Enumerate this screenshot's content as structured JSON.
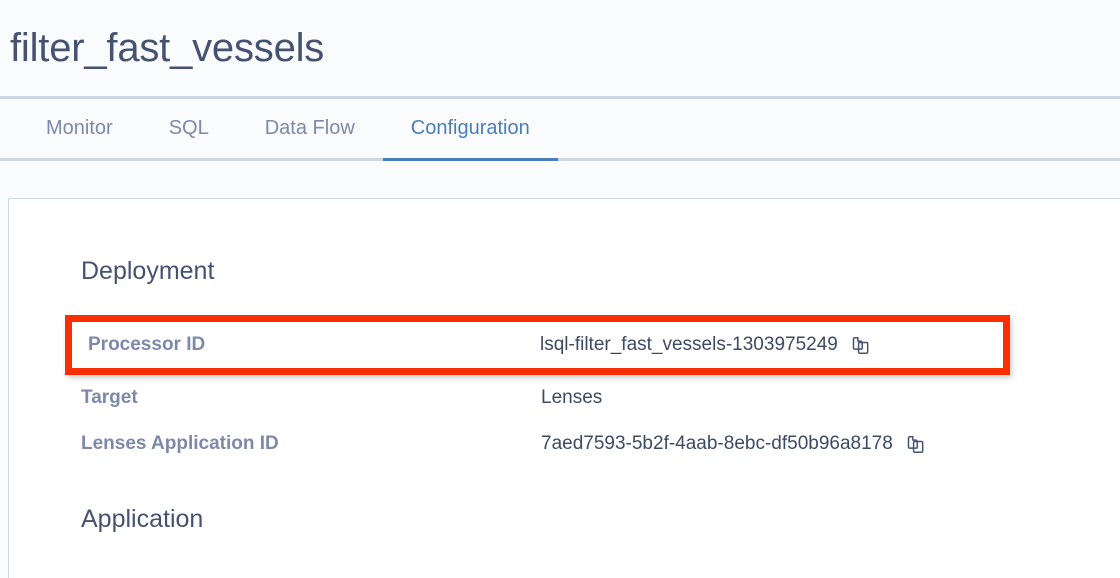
{
  "header": {
    "title": "filter_fast_vessels"
  },
  "tabs": [
    {
      "label": "Monitor",
      "active": false
    },
    {
      "label": "SQL",
      "active": false
    },
    {
      "label": "Data Flow",
      "active": false
    },
    {
      "label": "Configuration",
      "active": true
    }
  ],
  "sections": {
    "deployment": {
      "title": "Deployment",
      "rows": [
        {
          "label": "Processor ID",
          "value": "lsql-filter_fast_vessels-1303975249",
          "copy_icon": "copy-icon",
          "highlighted": true
        },
        {
          "label": "Target",
          "value": "Lenses",
          "copy_icon": null,
          "highlighted": false
        },
        {
          "label": "Lenses Application ID",
          "value": "7aed7593-5b2f-4aab-8ebc-df50b96a8178",
          "copy_icon": "copy-icon",
          "highlighted": false
        }
      ]
    },
    "application": {
      "title": "Application"
    }
  },
  "colors": {
    "accent": "#4a7ebb",
    "highlight": "#fb2e01",
    "label": "#7c89a8",
    "text": "#3d4a63",
    "border": "#ced6e5",
    "page_bg": "#fafbfd"
  }
}
